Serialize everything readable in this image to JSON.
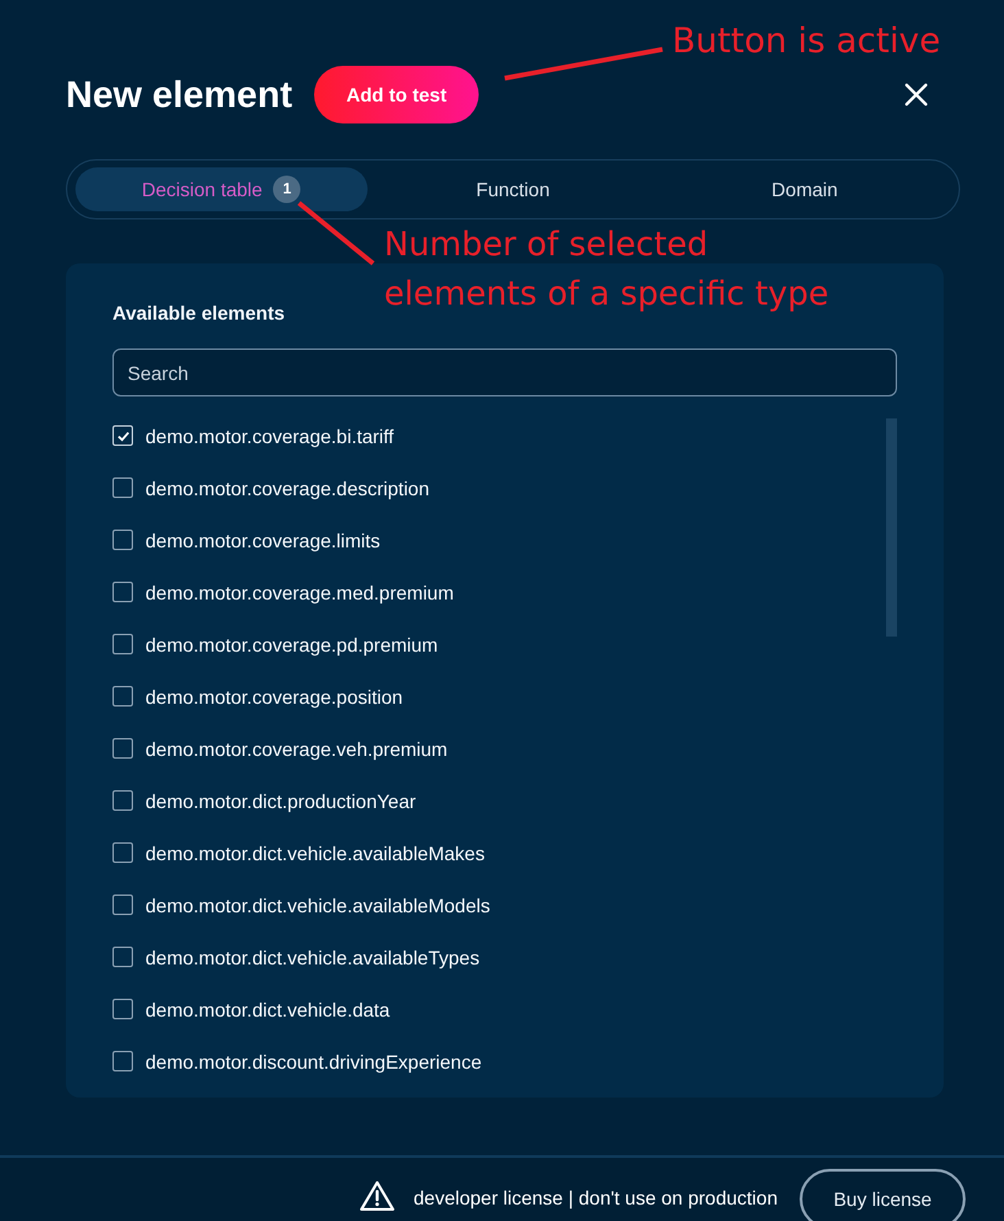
{
  "dialog": {
    "title": "New element",
    "add_button": {
      "label": "Add to test",
      "disabled": false
    }
  },
  "tabs": [
    {
      "label": "Decision table",
      "selected": true,
      "count": "1"
    },
    {
      "label": "Function",
      "selected": false
    },
    {
      "label": "Domain",
      "selected": false
    }
  ],
  "panel": {
    "heading": "Available elements",
    "search": {
      "placeholder": "Search"
    },
    "items": [
      {
        "label": "demo.motor.coverage.bi.tariff",
        "checked": true
      },
      {
        "label": "demo.motor.coverage.description",
        "checked": false
      },
      {
        "label": "demo.motor.coverage.limits",
        "checked": false
      },
      {
        "label": "demo.motor.coverage.med.premium",
        "checked": false
      },
      {
        "label": "demo.motor.coverage.pd.premium",
        "checked": false
      },
      {
        "label": "demo.motor.coverage.position",
        "checked": false
      },
      {
        "label": "demo.motor.coverage.veh.premium",
        "checked": false
      },
      {
        "label": "demo.motor.dict.productionYear",
        "checked": false
      },
      {
        "label": "demo.motor.dict.vehicle.availableMakes",
        "checked": false
      },
      {
        "label": "demo.motor.dict.vehicle.availableModels",
        "checked": false
      },
      {
        "label": "demo.motor.dict.vehicle.availableTypes",
        "checked": false
      },
      {
        "label": "demo.motor.dict.vehicle.data",
        "checked": false
      },
      {
        "label": "demo.motor.discount.drivingExperience",
        "checked": false
      }
    ]
  },
  "footer": {
    "notice": "developer license | don't use on production",
    "button": "Buy license"
  },
  "annotations": [
    {
      "text": "Button is active"
    },
    {
      "text": "Number of selected elements of a specific type"
    }
  ]
}
